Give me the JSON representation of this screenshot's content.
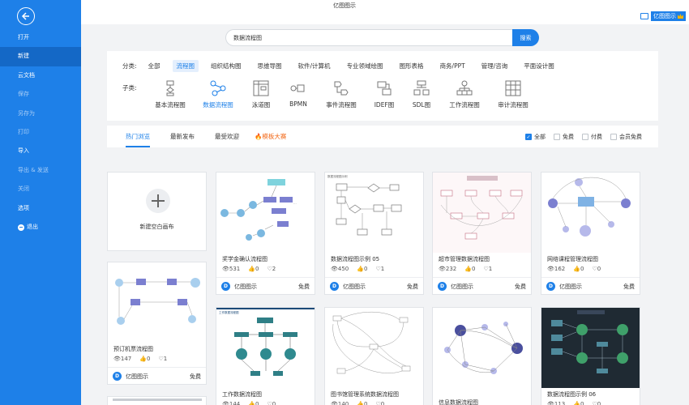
{
  "app": {
    "title": "亿图图示",
    "user": "亿图图示"
  },
  "sidebar": {
    "items": [
      {
        "label": "打开",
        "state": "normal"
      },
      {
        "label": "新建",
        "state": "active"
      },
      {
        "label": "云文档",
        "state": "normal"
      },
      {
        "label": "保存",
        "state": "dim"
      },
      {
        "label": "另存为",
        "state": "dim"
      },
      {
        "label": "打印",
        "state": "dim"
      },
      {
        "label": "导入",
        "state": "normal"
      },
      {
        "label": "导出 & 发送",
        "state": "dim"
      },
      {
        "label": "关闭",
        "state": "dim"
      },
      {
        "label": "选项",
        "state": "normal"
      },
      {
        "label": "退出",
        "state": "normal"
      }
    ]
  },
  "search": {
    "value": "数据流程图",
    "button": "搜索"
  },
  "categories": {
    "label": "分类:",
    "items": [
      "全部",
      "流程图",
      "组织结构图",
      "思维导图",
      "软件/计算机",
      "专业领域绘图",
      "图形表格",
      "商务/PPT",
      "管理/咨询",
      "平面设计图"
    ],
    "active": 1
  },
  "subcategories": {
    "label": "子类:",
    "items": [
      "基本流程图",
      "数据流程图",
      "泳道图",
      "BPMN",
      "事件流程图",
      "IDEF图",
      "SDL图",
      "工作流程图",
      "审计流程图"
    ],
    "active": 1
  },
  "tabs": [
    "热门浏览",
    "最新发布",
    "最受欢迎",
    "模板大赛"
  ],
  "filters": [
    "全部",
    "免费",
    "付费",
    "会员免费"
  ],
  "new_card": {
    "label": "新建空白画布"
  },
  "cards": [
    {
      "title": "奖学金确认流程图",
      "views": "531",
      "likes": "0",
      "favs": "2",
      "author": "亿图图示",
      "price": "免费"
    },
    {
      "title": "数据流程图示例 05",
      "views": "450",
      "likes": "0",
      "favs": "1",
      "author": "亿图图示",
      "price": "免费"
    },
    {
      "title": "超市管理数据流程图",
      "views": "232",
      "likes": "0",
      "favs": "1",
      "author": "亿图图示",
      "price": "免费"
    },
    {
      "title": "网络课程管理流程图",
      "views": "162",
      "likes": "0",
      "favs": "0",
      "author": "亿图图示",
      "price": "免费"
    },
    {
      "title": "预订机票流程图",
      "views": "147",
      "likes": "0",
      "favs": "1",
      "author": "亿图图示",
      "price": "免费"
    },
    {
      "title": "工作数据流程图",
      "views": "144",
      "likes": "0",
      "favs": "0",
      "author": "",
      "price": ""
    },
    {
      "title": "图书馆管理系统数据流程图",
      "views": "140",
      "likes": "0",
      "favs": "0",
      "author": "",
      "price": ""
    },
    {
      "title": "信息数据流程图",
      "views": "",
      "likes": "",
      "favs": "",
      "author": "",
      "price": ""
    },
    {
      "title": "数据流程图示例 06",
      "views": "113",
      "likes": "0",
      "favs": "0",
      "author": "",
      "price": ""
    }
  ]
}
